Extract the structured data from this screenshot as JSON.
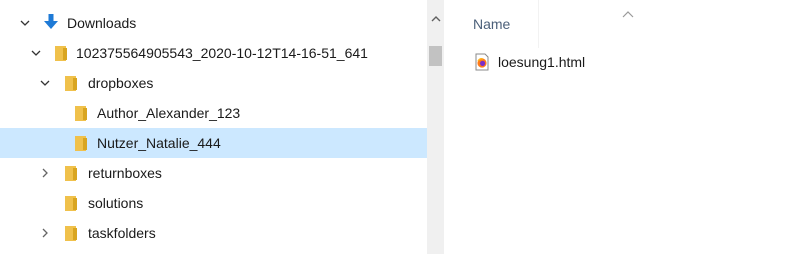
{
  "navigation": {
    "items": [
      {
        "label": "Downloads",
        "icon": "download-arrow-icon",
        "expanded": true,
        "selected": false
      },
      {
        "label": "102375564905543_2020-10-12T14-16-51_641",
        "icon": "folder-icon",
        "expanded": true,
        "selected": false
      },
      {
        "label": "dropboxes",
        "icon": "folder-icon",
        "expanded": true,
        "selected": false
      },
      {
        "label": "Author_Alexander_123",
        "icon": "folder-icon",
        "expanded": false,
        "selected": false
      },
      {
        "label": "Nutzer_Natalie_444",
        "icon": "folder-icon",
        "expanded": false,
        "selected": true
      },
      {
        "label": "returnboxes",
        "icon": "folder-icon",
        "expanded": false,
        "selected": false
      },
      {
        "label": "solutions",
        "icon": "folder-icon",
        "expanded": false,
        "selected": false
      },
      {
        "label": "taskfolders",
        "icon": "folder-icon",
        "expanded": false,
        "selected": false
      }
    ]
  },
  "content": {
    "columns": {
      "name": "Name"
    },
    "files": [
      {
        "name": "loesung1.html",
        "icon": "firefox-html-file-icon"
      }
    ]
  },
  "colors": {
    "selection": "#cce8ff",
    "folder": "#f0c14b",
    "download_arrow": "#1e7ad6",
    "header_text": "#4c607a"
  }
}
